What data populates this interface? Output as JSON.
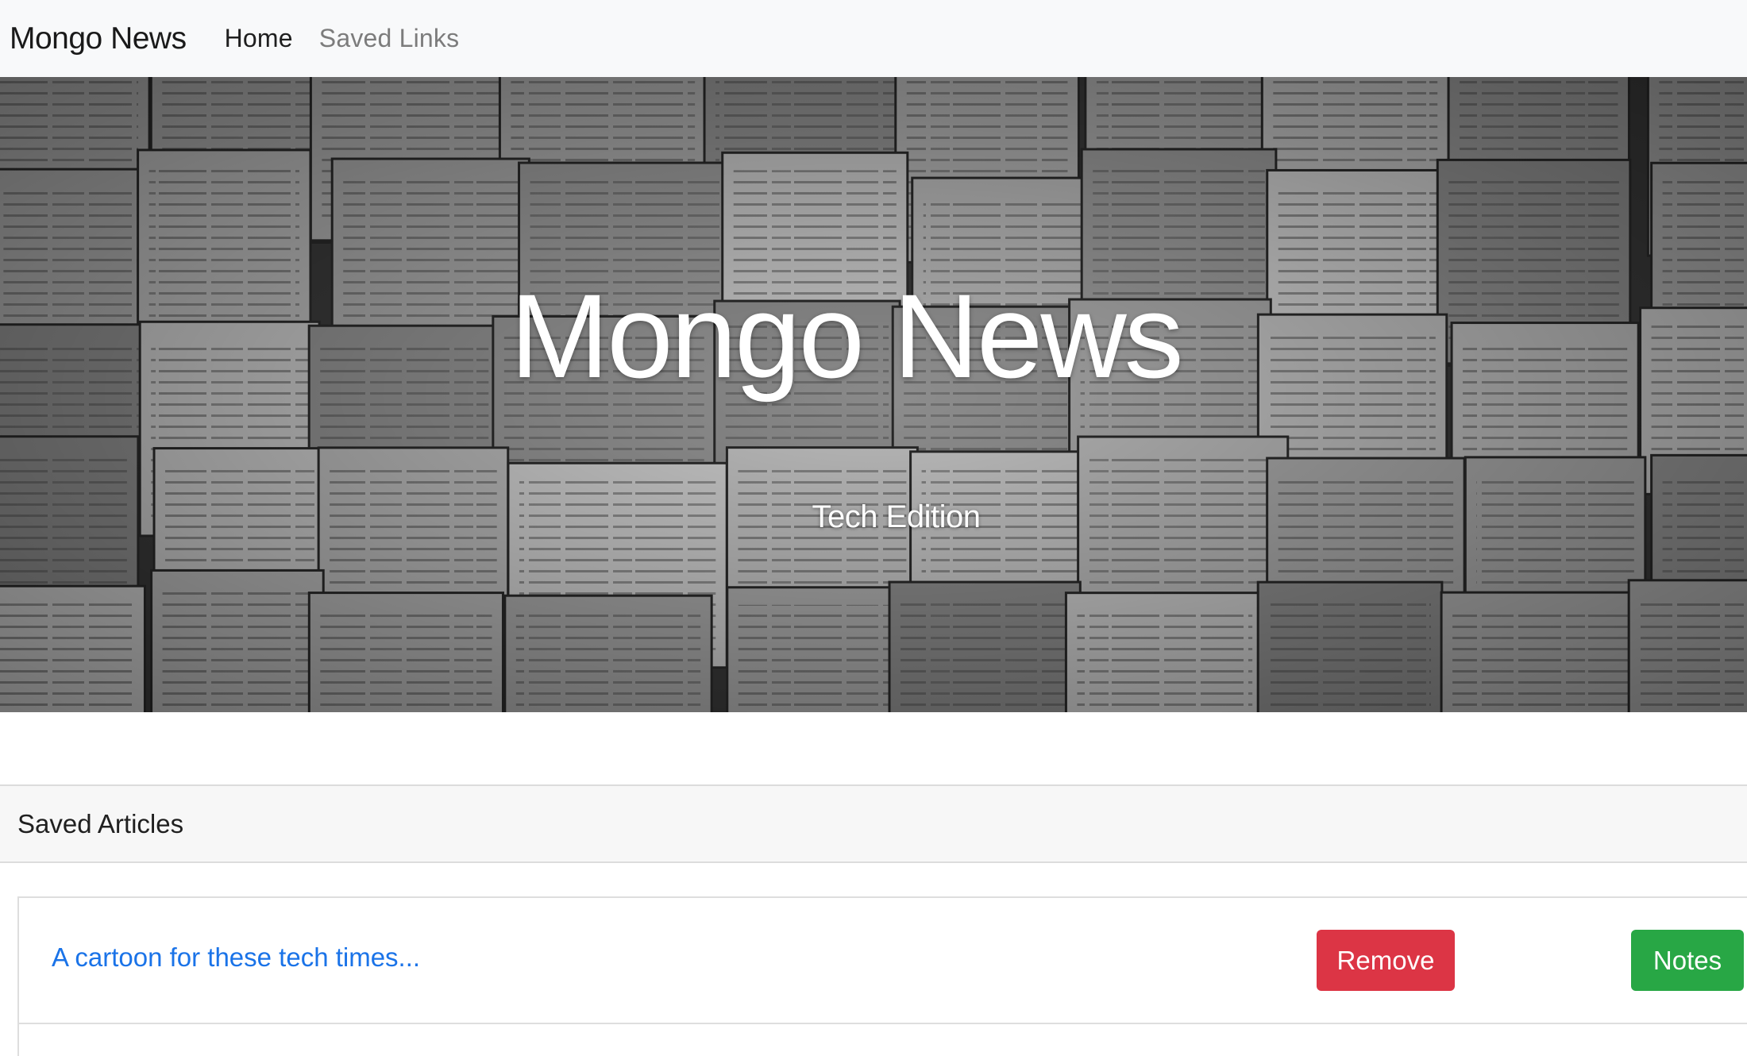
{
  "navbar": {
    "brand": "Mongo News",
    "links": [
      {
        "label": "Home",
        "active": true
      },
      {
        "label": "Saved Links",
        "active": false
      }
    ]
  },
  "hero": {
    "title": "Mongo News",
    "subtitle": "Tech Edition"
  },
  "saved": {
    "header": "Saved Articles",
    "articles": [
      {
        "title": "A cartoon for these tech times...",
        "remove_label": "Remove",
        "notes_label": "Notes"
      }
    ]
  },
  "colors": {
    "link": "#1a73e8",
    "danger": "#dc3545",
    "success": "#28a745",
    "navbar_bg": "#f8f9fa"
  }
}
